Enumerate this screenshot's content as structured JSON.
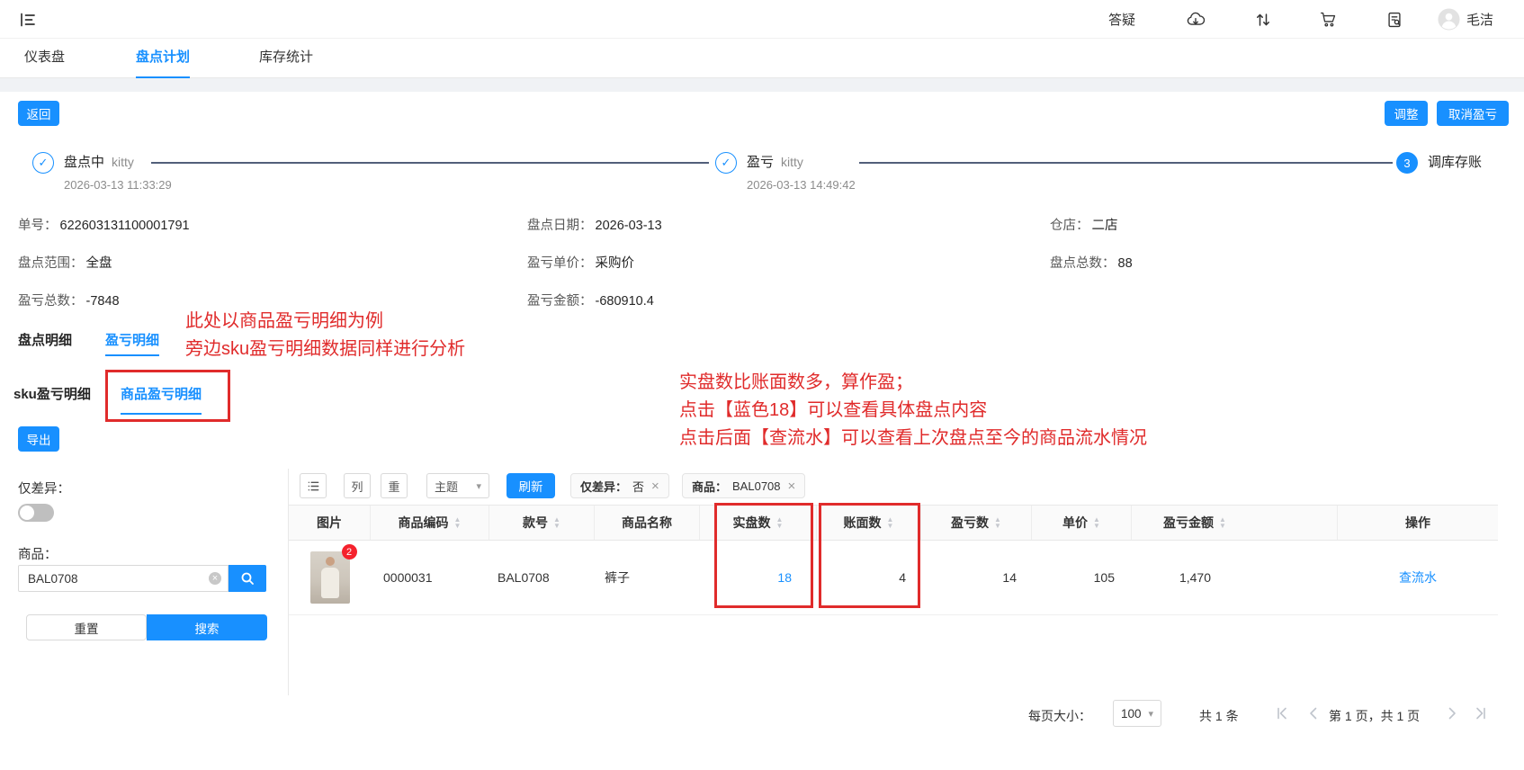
{
  "topbar": {
    "qa": "答疑",
    "username": "毛洁"
  },
  "nav_tabs": [
    {
      "label": "仪表盘"
    },
    {
      "label": "盘点计划"
    },
    {
      "label": "库存统计"
    }
  ],
  "actions": {
    "back": "返回",
    "adjust": "调整",
    "cancel_pl": "取消盈亏",
    "export": "导出",
    "refresh": "刷新",
    "reset": "重置",
    "search": "搜索",
    "theme": "主题",
    "columns": "列",
    "weight": "重"
  },
  "steps": [
    {
      "title": "盘点中",
      "operator": "kitty",
      "time": "2026-03-13 11:33:29"
    },
    {
      "title": "盈亏",
      "operator": "kitty",
      "time": "2026-03-13 14:49:42"
    },
    {
      "num": "3",
      "title": "调库存账"
    }
  ],
  "info_fields": [
    {
      "label": "单号：",
      "value": "622603131100001791"
    },
    {
      "label": "盘点日期：",
      "value": "2026-03-13"
    },
    {
      "label": "仓店：",
      "value": "二店"
    },
    {
      "label": "盘点范围：",
      "value": "全盘"
    },
    {
      "label": "盈亏单价：",
      "value": "采购价"
    },
    {
      "label": "盘点总数：",
      "value": "88"
    },
    {
      "label": "盈亏总数：",
      "value": "-7848"
    },
    {
      "label": "盈亏金额：",
      "value": "-680910.4"
    }
  ],
  "detail_tabs": [
    {
      "label": "盘点明细"
    },
    {
      "label": "盈亏明细"
    }
  ],
  "sub_tabs": [
    {
      "label": "sku盈亏明细"
    },
    {
      "label": "商品盈亏明细"
    }
  ],
  "annotations": {
    "note1": [
      "此处以商品盈亏明细为例",
      "旁边sku盈亏明细数据同样进行分析"
    ],
    "note2": [
      "实盘数比账面数多，算作盈；",
      "点击【蓝色18】可以查看具体盘点内容",
      "点击后面【查流水】可以查看上次盘点至今的商品流水情况"
    ]
  },
  "filters": {
    "diff_label": "仅差异：",
    "product_label": "商品：",
    "product_value": "BAL0708"
  },
  "chips": [
    {
      "label": "仅差异：",
      "value": "否"
    },
    {
      "label": "商品：",
      "value": "BAL0708"
    }
  ],
  "table": {
    "headers": [
      {
        "label": "图片",
        "sortable": false
      },
      {
        "label": "商品编码",
        "sortable": true
      },
      {
        "label": "款号",
        "sortable": true
      },
      {
        "label": "商品名称",
        "sortable": false
      },
      {
        "label": "实盘数",
        "sortable": true
      },
      {
        "label": "账面数",
        "sortable": true
      },
      {
        "label": "盈亏数",
        "sortable": true
      },
      {
        "label": "单价",
        "sortable": true
      },
      {
        "label": "盈亏金额",
        "sortable": true
      },
      {
        "label": "操作",
        "sortable": false
      }
    ],
    "row": {
      "badge": "2",
      "code": "0000031",
      "style_no": "BAL0708",
      "name": "裤子",
      "actual_qty": "18",
      "book_qty": "4",
      "pl_qty": "14",
      "unit_price": "105",
      "pl_amount": "1,470",
      "action": "查流水"
    }
  },
  "pagination": {
    "page_size_label": "每页大小：",
    "page_size": "100",
    "total": "共 1 条",
    "page_info": "第 1 页，共 1 页"
  },
  "glyphs": {
    "check": "✓",
    "caret_down": "▾",
    "close": "×",
    "sort_up": "▲",
    "sort_down": "▼"
  },
  "colors": {
    "primary": "#1890ff",
    "annotation_red": "#e02b2b",
    "header_bg": "#fafafa"
  }
}
